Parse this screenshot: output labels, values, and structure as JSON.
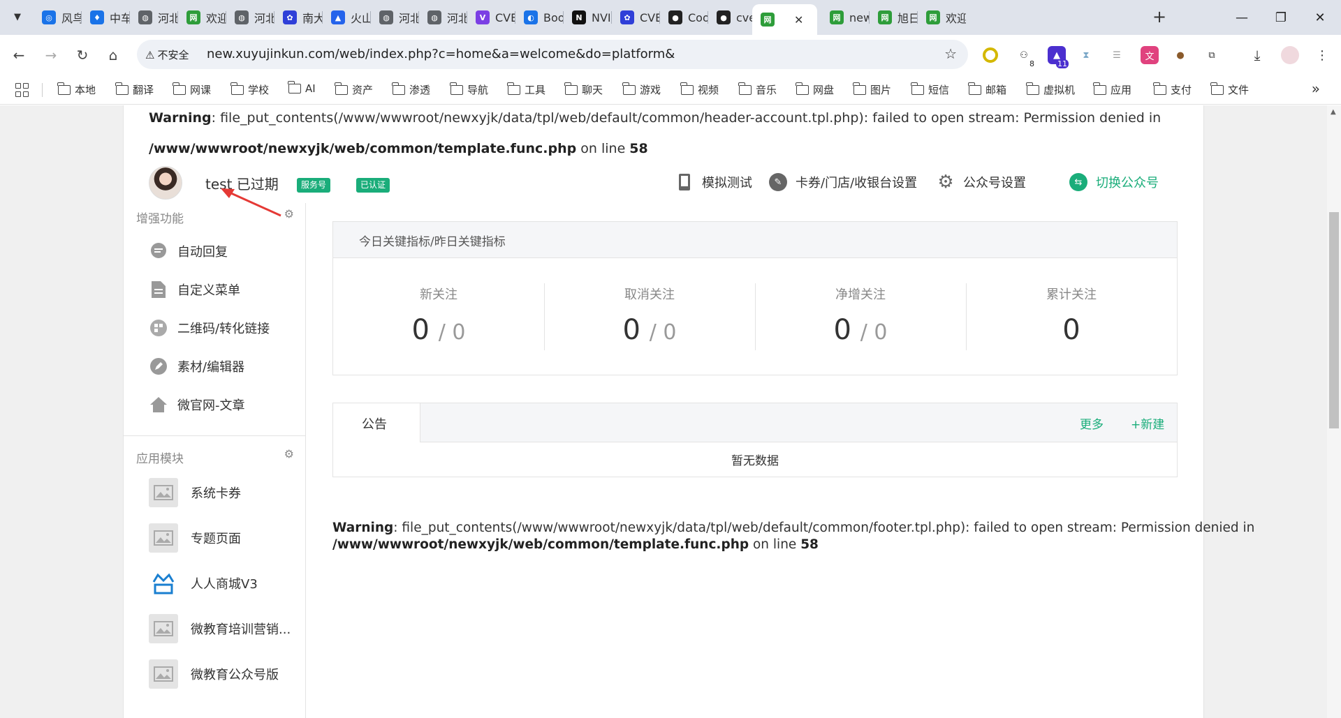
{
  "browser": {
    "tabs": [
      {
        "title": "风鸟",
        "color": "#1a73e8",
        "glyph": "◎"
      },
      {
        "title": "中车",
        "color": "#1a73e8",
        "glyph": "♦"
      },
      {
        "title": "河北",
        "color": "#5f6368",
        "glyph": "◍"
      },
      {
        "title": "欢迎",
        "color": "#2e9d3a",
        "glyph": "网"
      },
      {
        "title": "河北",
        "color": "#5f6368",
        "glyph": "◍"
      },
      {
        "title": "南大",
        "color": "#2f3fd8",
        "glyph": "✿"
      },
      {
        "title": "火山",
        "color": "#2463eb",
        "glyph": "▲"
      },
      {
        "title": "河北",
        "color": "#5f6368",
        "glyph": "◍"
      },
      {
        "title": "河北",
        "color": "#5f6368",
        "glyph": "◍"
      },
      {
        "title": "CVE",
        "color": "#7b3fe4",
        "glyph": "V"
      },
      {
        "title": "Boo",
        "color": "#1a73e8",
        "glyph": "◐"
      },
      {
        "title": "NVI",
        "color": "#111111",
        "glyph": "N"
      },
      {
        "title": "CVE",
        "color": "#2f3fd8",
        "glyph": "✿"
      },
      {
        "title": "Coo",
        "color": "#222222",
        "glyph": "●"
      },
      {
        "title": "cve",
        "color": "#222222",
        "glyph": "●"
      },
      {
        "title": "",
        "color": "#2e9d3a",
        "glyph": "网"
      },
      {
        "title": "new",
        "color": "#2e9d3a",
        "glyph": "网"
      },
      {
        "title": "旭日",
        "color": "#2e9d3a",
        "glyph": "网"
      },
      {
        "title": "欢迎",
        "color": "#2e9d3a",
        "glyph": "网"
      }
    ],
    "active_tab_index": 15,
    "close_glyph": "✕",
    "new_tab_glyph": "+",
    "omnibox": {
      "security_label": "不安全",
      "url": "new.xuyujinkun.com/web/index.php?c=home&a=welcome&do=platform&"
    },
    "extension_badges": {
      "second": "8",
      "third": "11"
    },
    "bookmarks": [
      "本地",
      "翻译",
      "网课",
      "学校",
      "AI",
      "资产",
      "渗透",
      "导航",
      "工具",
      "聊天",
      "游戏",
      "视频",
      "音乐",
      "网盘",
      "图片",
      "短信",
      "邮箱",
      "虚拟机",
      "应用",
      "支付",
      "文件"
    ]
  },
  "warnings": {
    "top": {
      "label": "Warning",
      "message": ": file_put_contents(/www/wwwroot/newxyjk/data/tpl/web/default/common/header-account.tpl.php): failed to open stream: Permission denied in",
      "path": "/www/wwwroot/newxyjk/web/common/template.func.php",
      "on_line": " on line ",
      "line": "58"
    },
    "bottom": {
      "label": "Warning",
      "message": ": file_put_contents(/www/wwwroot/newxyjk/data/tpl/web/default/common/footer.tpl.php): failed to open stream: Permission denied in",
      "path": "/www/wwwroot/newxyjk/web/common/template.func.php",
      "on_line": " on line ",
      "line": "58"
    }
  },
  "account": {
    "name": "test 已过期",
    "badges": [
      "服务号",
      "已认证"
    ],
    "actions": {
      "simulate": "模拟测试",
      "card_settings": "卡券/门店/收银台设置",
      "account_settings": "公众号设置",
      "switch_account": "切换公众号"
    }
  },
  "sidebar": {
    "enhanced_title": "增强功能",
    "enhanced_items": [
      "自动回复",
      "自定义菜单",
      "二维码/转化链接",
      "素材/编辑器",
      "微官网-文章"
    ],
    "modules_title": "应用模块",
    "modules_items": [
      "系统卡券",
      "专题页面",
      "人人商城V3",
      "微教育培训营销...",
      "微教育公众号版"
    ]
  },
  "stats": {
    "title": "今日关键指标/昨日关键指标",
    "items": [
      {
        "label": "新关注",
        "today": "0",
        "yesterday": "/ 0"
      },
      {
        "label": "取消关注",
        "today": "0",
        "yesterday": "/ 0"
      },
      {
        "label": "净增关注",
        "today": "0",
        "yesterday": "/ 0"
      },
      {
        "label": "累计关注",
        "today": "0",
        "yesterday": ""
      }
    ]
  },
  "notice": {
    "tab": "公告",
    "more": "更多",
    "create": "+新建",
    "empty": "暂无数据"
  },
  "colors": {
    "accent": "#1aad7a",
    "annotation_arrow": "#e53935",
    "tabbar_bg": "#dfe3eb",
    "page_bg": "#f0f0f0"
  }
}
